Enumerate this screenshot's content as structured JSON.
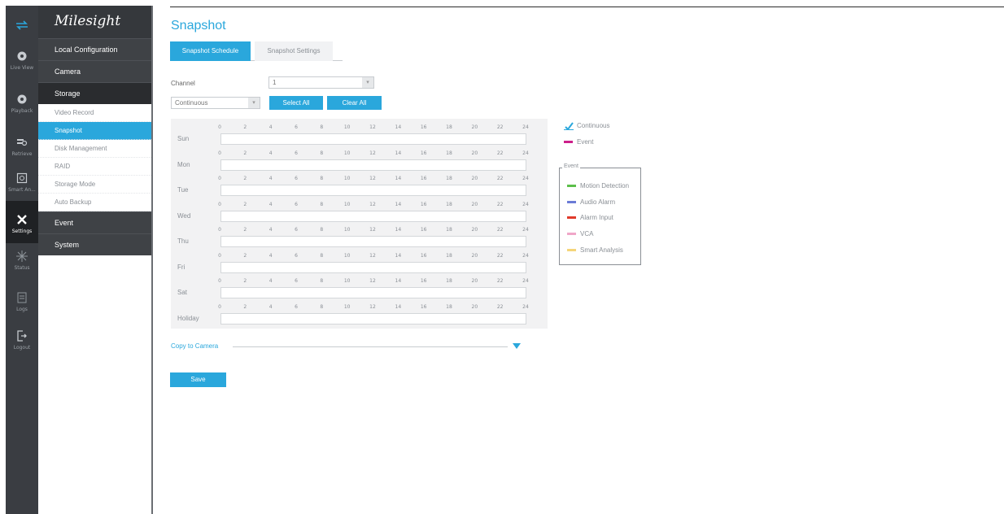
{
  "rail": [
    {
      "label": "",
      "icon": "swap-arrows-icon"
    },
    {
      "label": "Live View",
      "icon": "live-view-icon"
    },
    {
      "label": "Playback",
      "icon": "playback-icon"
    },
    {
      "label": "Retrieve",
      "icon": "retrieve-icon"
    },
    {
      "label": "Smart An...",
      "icon": "smart-analysis-icon"
    },
    {
      "label": "Settings",
      "icon": "settings-icon"
    },
    {
      "label": "Status",
      "icon": "status-icon"
    },
    {
      "label": "Logs",
      "icon": "logs-icon"
    },
    {
      "label": "Logout",
      "icon": "logout-icon"
    }
  ],
  "logo": "Milesight",
  "menu": {
    "local_configuration": "Local Configuration",
    "camera": "Camera",
    "storage": "Storage",
    "storage_items": [
      "Video Record",
      "Snapshot",
      "Disk Management",
      "RAID",
      "Storage Mode",
      "Auto Backup"
    ],
    "event": "Event",
    "system": "System"
  },
  "page": {
    "title": "Snapshot",
    "tabs": [
      "Snapshot Schedule",
      "Snapshot Settings"
    ]
  },
  "form": {
    "channel_label": "Channel",
    "channel_value": "1",
    "mode_value": "Continuous",
    "select_all": "Select All",
    "clear_all": "Clear All"
  },
  "schedule": {
    "ticks": [
      "0",
      "2",
      "4",
      "6",
      "8",
      "10",
      "12",
      "14",
      "16",
      "18",
      "20",
      "22",
      "24"
    ],
    "days": [
      "Sun",
      "Mon",
      "Tue",
      "Wed",
      "Thu",
      "Fri",
      "Sat",
      "Holiday"
    ]
  },
  "legend": {
    "continuous": {
      "label": "Continuous",
      "color": "#2aa7dc"
    },
    "event": {
      "label": "Event",
      "color": "#cc1f8a"
    },
    "event_group_title": "Event",
    "event_types": [
      {
        "label": "Motion Detection",
        "color": "#5cbf4a"
      },
      {
        "label": "Audio Alarm",
        "color": "#6b7bd6"
      },
      {
        "label": "Alarm Input",
        "color": "#e03a2a"
      },
      {
        "label": "VCA",
        "color": "#f0a6c8"
      },
      {
        "label": "Smart Analysis",
        "color": "#f5d57a"
      }
    ]
  },
  "copy_to_camera": "Copy to Camera",
  "save": "Save"
}
